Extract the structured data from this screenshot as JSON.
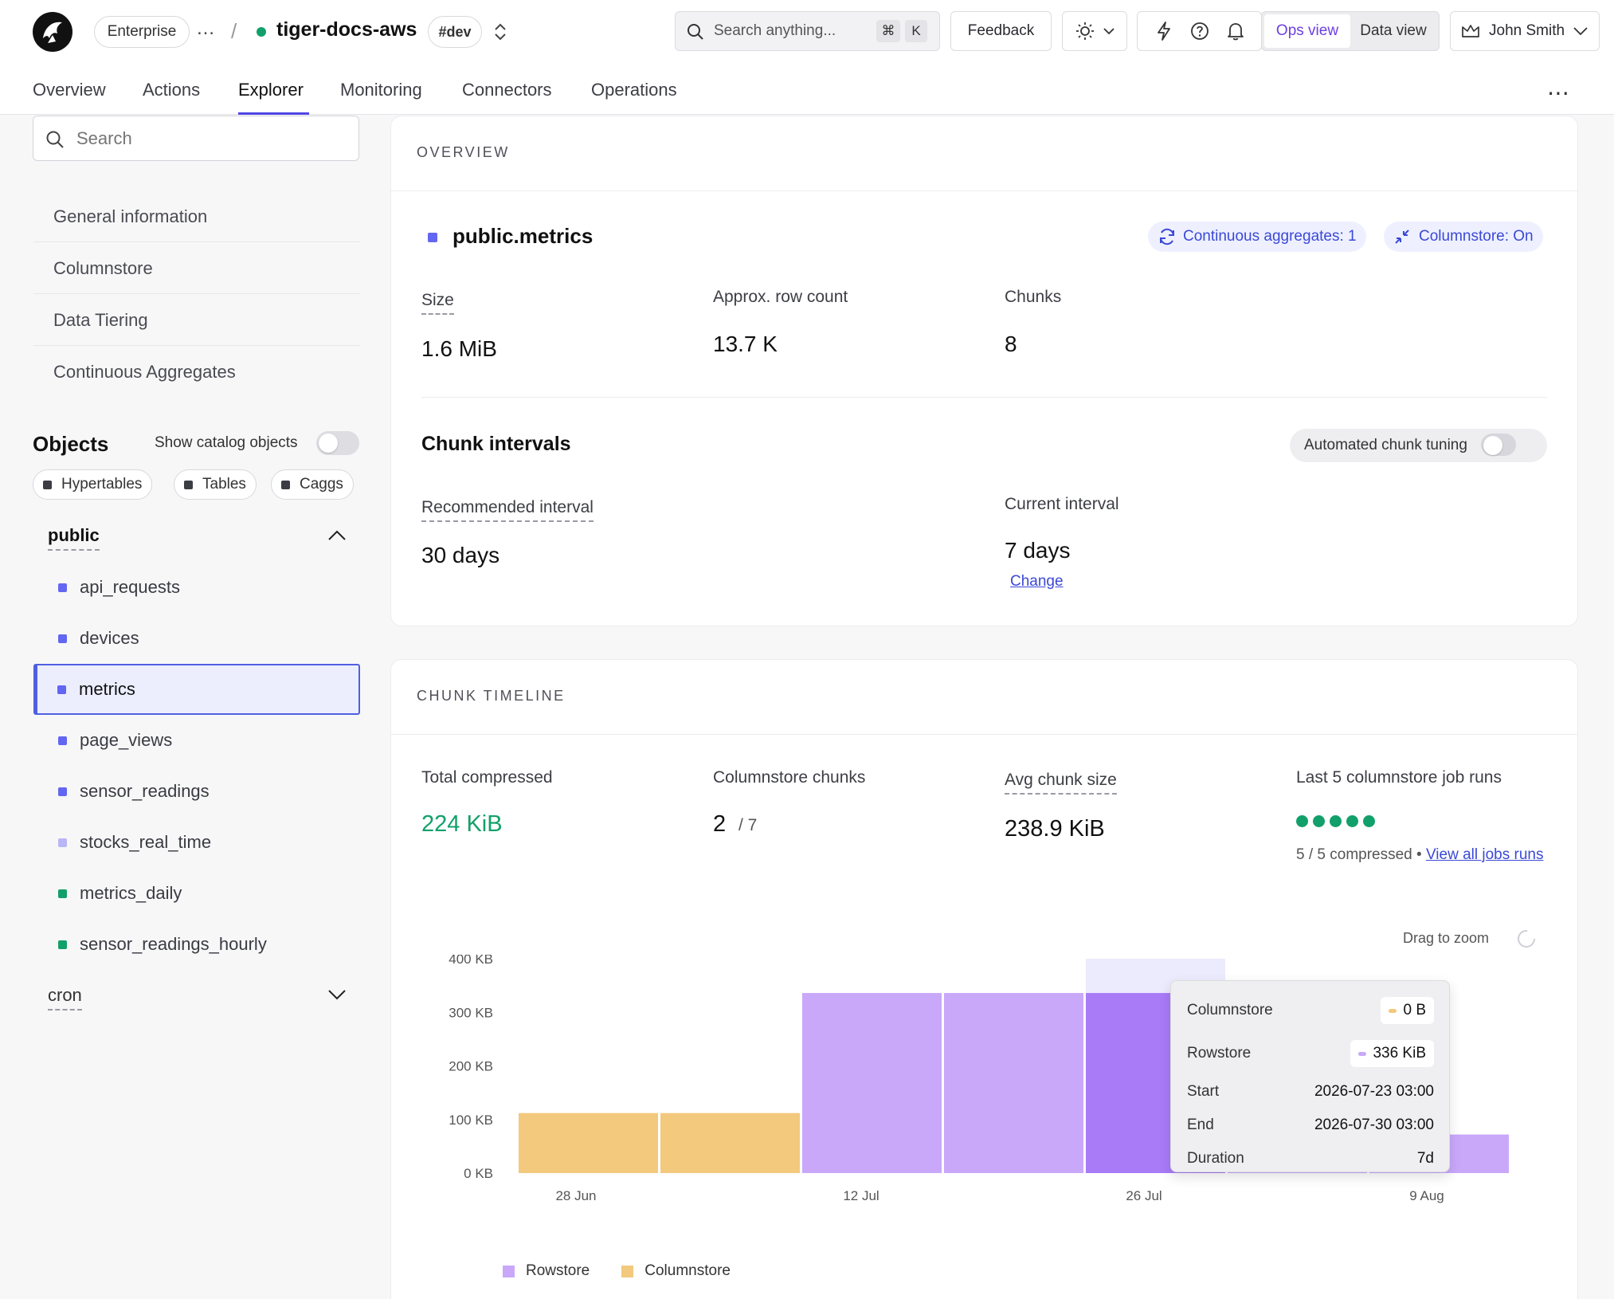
{
  "header": {
    "plan_badge": "Enterprise",
    "more_label": "…",
    "separator": "/",
    "service_name": "tiger-docs-aws",
    "env_badge": "#dev",
    "search_placeholder": "Search anything...",
    "search_shortcut_mod": "⌘",
    "search_shortcut_key": "K",
    "feedback_label": "Feedback",
    "ops_view_label": "Ops view",
    "data_view_label": "Data view",
    "user_name": "John Smith",
    "status_color": "#12a06a",
    "accent_color": "#6d3fe0"
  },
  "tabs": [
    {
      "label": "Overview"
    },
    {
      "label": "Actions"
    },
    {
      "label": "Explorer",
      "active": true
    },
    {
      "label": "Monitoring"
    },
    {
      "label": "Connectors"
    },
    {
      "label": "Operations"
    }
  ],
  "sidebar": {
    "search_placeholder": "Search",
    "sections": [
      "General information",
      "Columnstore",
      "Data Tiering",
      "Continuous Aggregates"
    ],
    "objects_title": "Objects",
    "show_catalog_label": "Show catalog objects",
    "filters": [
      "Hypertables",
      "Tables",
      "Caggs"
    ],
    "schema_public": "public",
    "objects": [
      {
        "name": "api_requests",
        "color": "#6366f1"
      },
      {
        "name": "devices",
        "color": "#6366f1"
      },
      {
        "name": "metrics",
        "color": "#6366f1",
        "selected": true
      },
      {
        "name": "page_views",
        "color": "#6366f1"
      },
      {
        "name": "sensor_readings",
        "color": "#6366f1"
      },
      {
        "name": "stocks_real_time",
        "color": "#b8b6f5"
      },
      {
        "name": "metrics_daily",
        "color": "#12a06a"
      },
      {
        "name": "sensor_readings_hourly",
        "color": "#12a06a"
      }
    ],
    "schema_cron": "cron"
  },
  "overview": {
    "section_label": "OVERVIEW",
    "table_name": "public.metrics",
    "badge_caggs": "Continuous aggregates: 1",
    "badge_columnstore": "Columnstore: On",
    "size_label": "Size",
    "size_value": "1.6 MiB",
    "rows_label": "Approx. row count",
    "rows_value": "13.7 K",
    "chunks_label": "Chunks",
    "chunks_value": "8",
    "chunk_intervals_title": "Chunk intervals",
    "auto_tuning_label": "Automated chunk tuning",
    "recommended_label": "Recommended interval",
    "recommended_value": "30 days",
    "current_label": "Current interval",
    "current_value": "7 days",
    "change_link": "Change"
  },
  "timeline": {
    "section_label": "CHUNK TIMELINE",
    "total_compressed_label": "Total compressed",
    "total_compressed_value": "224 KiB",
    "columnstore_chunks_label": "Columnstore chunks",
    "columnstore_chunks_value": "2",
    "columnstore_chunks_total": "/ 7",
    "avg_chunk_label": "Avg chunk size",
    "avg_chunk_value": "238.9 KiB",
    "job_runs_label": "Last 5 columnstore job runs",
    "job_runs_summary": "5 / 5 compressed •",
    "job_runs_link": "View all jobs runs",
    "drag_zoom_label": "Drag to zoom",
    "tooltip": {
      "columnstore_label": "Columnstore",
      "columnstore_value": "0 B",
      "rowstore_label": "Rowstore",
      "rowstore_value": "336 KiB",
      "start_label": "Start",
      "start_value": "2026-07-23 03:00",
      "end_label": "End",
      "end_value": "2026-07-30 03:00",
      "duration_label": "Duration",
      "duration_value": "7d"
    }
  },
  "chart_data": {
    "type": "bar",
    "stacked": true,
    "categories": [
      "chunk1",
      "chunk2",
      "chunk3",
      "chunk4",
      "chunk5",
      "chunk6",
      "chunk7"
    ],
    "x_tick_labels": [
      "28 Jun",
      "12 Jul",
      "26 Jul",
      "9 Aug"
    ],
    "y_tick_labels": [
      "0 KB",
      "100 KB",
      "200 KB",
      "300 KB",
      "400 KB"
    ],
    "ylim": [
      0,
      400
    ],
    "series": [
      {
        "name": "Columnstore",
        "color": "#f2c97d",
        "values": [
          112,
          112,
          0,
          0,
          0,
          0,
          0
        ]
      },
      {
        "name": "Rowstore",
        "color": "#c9a8fa",
        "values": [
          0,
          0,
          336,
          336,
          336,
          72,
          72
        ]
      }
    ],
    "highlighted_index": 4,
    "highlight_color": "#a97bf7",
    "legend_position": "bottom-left"
  }
}
